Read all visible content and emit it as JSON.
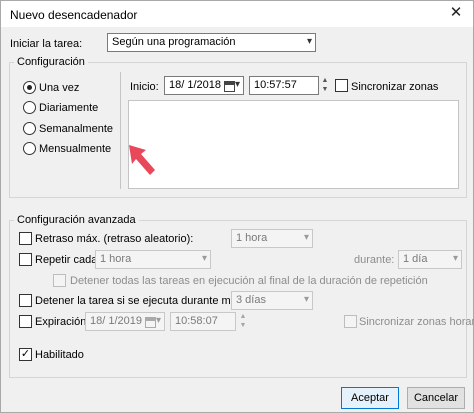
{
  "window": {
    "title": "Nuevo desencadenador",
    "close_glyph": "✕"
  },
  "start_task": {
    "label": "Iniciar la tarea:",
    "value": "Según una programación"
  },
  "config": {
    "legend": "Configuración",
    "radios": [
      {
        "label": "Una vez",
        "selected": true
      },
      {
        "label": "Diariamente",
        "selected": false
      },
      {
        "label": "Semanalmente",
        "selected": false
      },
      {
        "label": "Mensualmente",
        "selected": false
      }
    ],
    "start_label": "Inicio:",
    "start_date": "18/ 1/2018",
    "start_time": "10:57:57",
    "sync_label": "Sincronizar zonas"
  },
  "advanced": {
    "legend": "Configuración avanzada",
    "delay": {
      "label": "Retraso máx. (retraso aleatorio):",
      "value": "1 hora",
      "checked": false
    },
    "repeat": {
      "label": "Repetir cada:",
      "value": "1 hora",
      "checked": false,
      "duration_label": "durante:",
      "duration_value": "1 día"
    },
    "stop_all": {
      "label": "Detener todas las tareas en ejecución al final de la duración de repetición",
      "checked": false
    },
    "stop_if": {
      "label": "Detener la tarea si se ejecuta durante más de:",
      "value": "3 días",
      "checked": false
    },
    "expiration": {
      "label": "Expiración:",
      "date": "18/ 1/2019",
      "time": "10:58:07",
      "checked": false,
      "sync_label": "Sincronizar zonas horaria"
    },
    "enabled": {
      "label": "Habilitado",
      "checked": true
    }
  },
  "buttons": {
    "accept": "Aceptar",
    "cancel": "Cancelar"
  },
  "colors": {
    "arrow": "#e8485a",
    "accent": "#0078d7"
  }
}
